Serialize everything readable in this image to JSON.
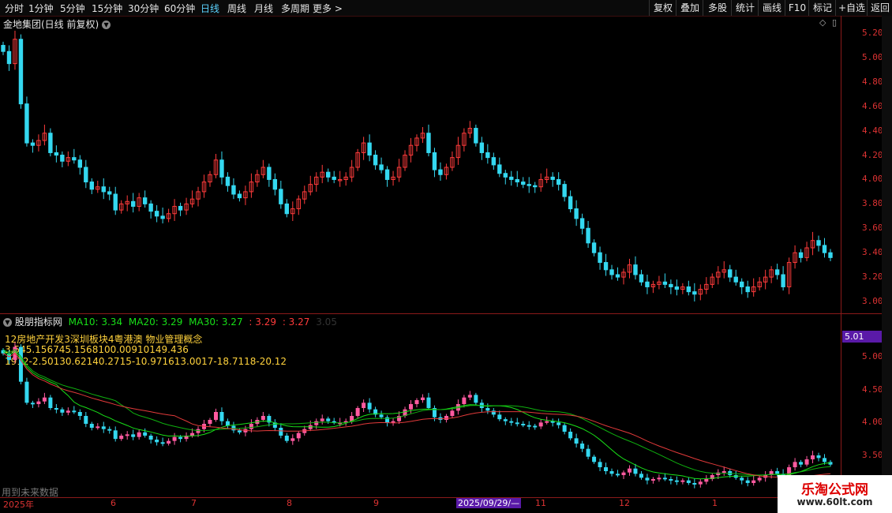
{
  "toolbar": {
    "periods": [
      "分时",
      "1分钟",
      "5分钟",
      "15分钟",
      "30分钟",
      "60分钟",
      "日线",
      "周线",
      "月线",
      "多周期",
      "更多 >"
    ],
    "active_period": "日线",
    "tools": [
      "复权",
      "叠加",
      "多股",
      "统计",
      "画线",
      "F10",
      "标记",
      "+自选",
      "返回"
    ]
  },
  "main_chart": {
    "title": "金地集团(日线 前复权)",
    "price_ticks": [
      "5.20",
      "5.00",
      "4.80",
      "4.60",
      "4.40",
      "4.20",
      "4.00",
      "3.80",
      "3.60",
      "3.40",
      "3.20",
      "3.00"
    ]
  },
  "indicator": {
    "name": "股朋指标网",
    "ma10": "MA10: 3.34",
    "ma20": "MA20: 3.29",
    "ma30": "MA30: 3.27",
    "v1": ": 3.29",
    "v2": ": 3.27",
    "v3": "3.05",
    "concepts": "12房地产开发3深圳板块4粤港澳 物业管理概念",
    "line2": "3.545.156745.1568100.00910149.436",
    "line3": "1912-2.50130.62140.2715-10.971613.0017-18.7118-20.12",
    "price_ticks": [
      "5.00",
      "4.50",
      "4.00",
      "3.50"
    ],
    "current_price": "5.01",
    "footer": "用到未来数据"
  },
  "dates": {
    "labels": [
      "2025年",
      "6",
      "7",
      "8",
      "9",
      "2025/09/29/—",
      "11",
      "12",
      "1"
    ]
  },
  "watermark": {
    "title": "乐淘公式网",
    "url": "www.60lt.com"
  },
  "colors": {
    "up": "#ff3b3b",
    "down": "#34d8f0",
    "up2": "#ff5aa0",
    "ma10": "#e8e8e8",
    "ma20": "#ffd23c",
    "ma30": "#18e018"
  },
  "chart_data": {
    "type": "candlestick",
    "ylim": [
      2.95,
      5.25
    ],
    "close": [
      5.05,
      4.95,
      5.15,
      4.62,
      4.3,
      4.28,
      4.32,
      4.38,
      4.22,
      4.2,
      4.15,
      4.18,
      4.16,
      4.1,
      3.98,
      3.92,
      3.94,
      3.9,
      3.88,
      3.75,
      3.8,
      3.82,
      3.78,
      3.85,
      3.8,
      3.74,
      3.7,
      3.68,
      3.72,
      3.78,
      3.75,
      3.8,
      3.84,
      3.9,
      3.98,
      4.04,
      4.16,
      4.02,
      3.95,
      3.88,
      3.85,
      3.9,
      3.98,
      4.04,
      4.1,
      4.0,
      3.92,
      3.8,
      3.72,
      3.76,
      3.84,
      3.9,
      3.96,
      4.02,
      4.06,
      4.02,
      4.0,
      4.0,
      4.02,
      4.1,
      4.22,
      4.3,
      4.2,
      4.12,
      4.08,
      4.0,
      4.02,
      4.1,
      4.2,
      4.28,
      4.34,
      4.38,
      4.22,
      4.08,
      4.04,
      4.1,
      4.18,
      4.28,
      4.38,
      4.42,
      4.3,
      4.22,
      4.18,
      4.12,
      4.05,
      4.02,
      4.0,
      3.98,
      3.96,
      3.95,
      3.94,
      4.0,
      4.02,
      4.0,
      3.96,
      3.86,
      3.76,
      3.68,
      3.6,
      3.48,
      3.4,
      3.32,
      3.26,
      3.22,
      3.2,
      3.24,
      3.3,
      3.22,
      3.16,
      3.12,
      3.14,
      3.16,
      3.14,
      3.12,
      3.1,
      3.12,
      3.08,
      3.06,
      3.1,
      3.14,
      3.2,
      3.24,
      3.26,
      3.2,
      3.16,
      3.12,
      3.08,
      3.12,
      3.16,
      3.2,
      3.26,
      3.22,
      3.12,
      3.32,
      3.4,
      3.36,
      3.44,
      3.5,
      3.46,
      3.4,
      3.36
    ]
  }
}
